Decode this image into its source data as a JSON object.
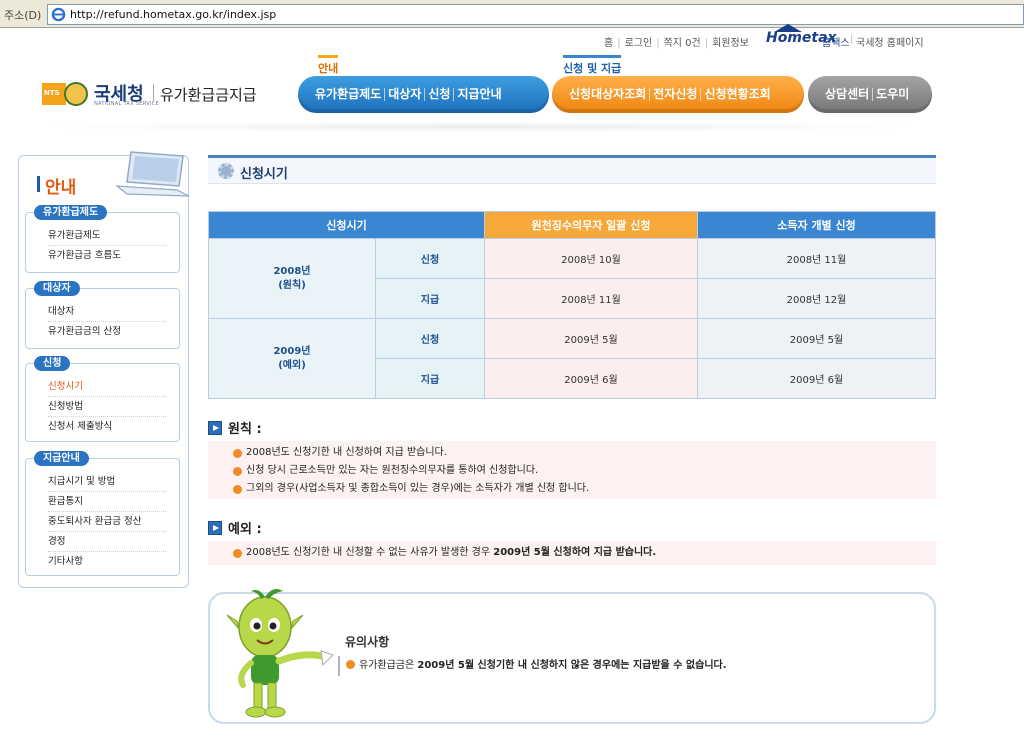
{
  "browser": {
    "address_label": "주소(D)",
    "url": "http://refund.hometax.go.kr/index.jsp"
  },
  "header": {
    "toplinks": [
      "홈",
      "로그인",
      "쪽지 0건",
      "회원정보"
    ],
    "hometax_logo": "Hometax",
    "hometax_link": "홈택스",
    "nts_home": "국세청 홈페이지",
    "nts_badge": "NTS",
    "nts_title": "국세청",
    "nts_sub": "NATIONAL TAX SERVICE",
    "brand_name": "유가환급금지급"
  },
  "nav": {
    "group_a_label": "안내",
    "group_b_label": "신청 및 지급",
    "group_a": [
      "유가환급제도",
      "대상자",
      "신청",
      "지급안내"
    ],
    "group_b": [
      "신청대상자조회",
      "전자신청",
      "신청현황조회"
    ],
    "group_c": [
      "상담센터",
      "도우미"
    ]
  },
  "sidebar": {
    "title": "안내",
    "groups": [
      {
        "badge": "유가환급제도",
        "items": [
          "유가환급제도",
          "유가환급금 흐름도"
        ]
      },
      {
        "badge": "대상자",
        "items": [
          "대상자",
          "유가환급금의 산정"
        ]
      },
      {
        "badge": "신청",
        "items": [
          "신청시기",
          "신청방법",
          "신청서 제출방식"
        ]
      },
      {
        "badge": "지급안내",
        "items": [
          "지급시기 및 방법",
          "환급통지",
          "중도퇴사자 환급금 정산",
          "경정",
          "기타사항"
        ]
      }
    ]
  },
  "content": {
    "title": "신청시기",
    "table": {
      "headers": [
        "신청시기",
        "원천징수의무자 일괄 신청",
        "소득자 개별 신청"
      ],
      "rows": [
        {
          "year": "2008년",
          "year_sub": "(원칙)",
          "kind": "신청",
          "col2": "2008년 10월",
          "col3": "2008년 11월"
        },
        {
          "kind": "지급",
          "col2": "2008년 11월",
          "col3": "2008년 12월"
        },
        {
          "year": "2009년",
          "year_sub": "(예외)",
          "kind": "신청",
          "col2": "2009년 5월",
          "col3": "2009년 5월"
        },
        {
          "kind": "지급",
          "col2": "2009년 6월",
          "col3": "2009년 6월"
        }
      ]
    },
    "principle": {
      "heading": "원칙 :",
      "bullets": [
        "2008년도 신청기한 내 신청하여 지급 받습니다.",
        "신청 당시 근로소득만 있는 자는 원천징수의무자를 통하여 신청합니다.",
        "그외의 경우(사업소득자 및 종합소득이 있는 경우)에는 소득자가 개별 신청 합니다."
      ]
    },
    "exception": {
      "heading": "예외 :",
      "bullet_normal": "2008년도 신청기한 내 신청할 수 없는 사유가 발생한 경우 ",
      "bullet_bold": "2009년 5월 신청하여 지급 받습니다."
    },
    "notice": {
      "title": "유의사항",
      "text_normal": "유가환급금은 ",
      "text_bold": "2009년 5월 신청기한 내 신청하지 않은 경우에는 지급받을 수 없습니다."
    }
  }
}
